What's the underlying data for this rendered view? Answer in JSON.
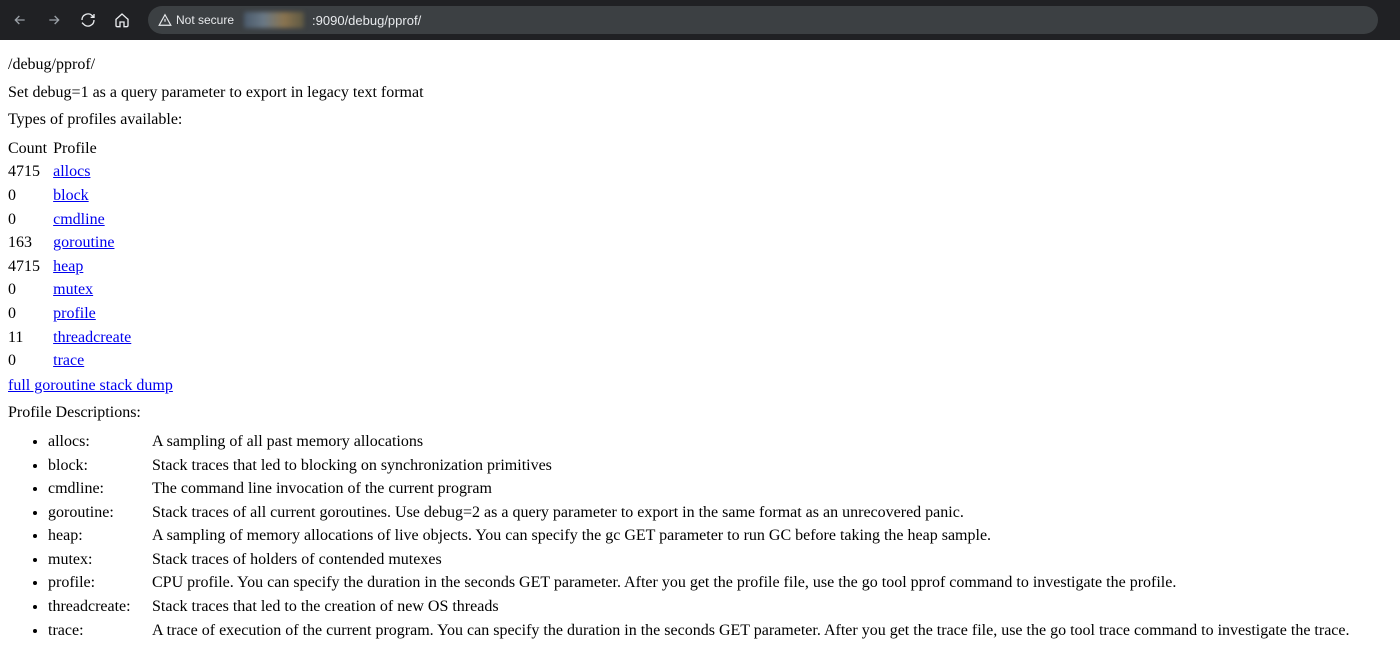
{
  "chrome": {
    "not_secure_label": "Not secure",
    "url": ":9090/debug/pprof/"
  },
  "page": {
    "heading": "/debug/pprof/",
    "subtext": "Set debug=1 as a query parameter to export in legacy text format",
    "types_label": "Types of profiles available:",
    "table_headers": {
      "count": "Count",
      "profile": "Profile"
    },
    "profiles": [
      {
        "count": "4715",
        "name": "allocs"
      },
      {
        "count": "0",
        "name": "block"
      },
      {
        "count": "0",
        "name": "cmdline"
      },
      {
        "count": "163",
        "name": "goroutine"
      },
      {
        "count": "4715",
        "name": "heap"
      },
      {
        "count": "0",
        "name": "mutex"
      },
      {
        "count": "0",
        "name": "profile"
      },
      {
        "count": "11",
        "name": "threadcreate"
      },
      {
        "count": "0",
        "name": "trace"
      }
    ],
    "full_dump_label": "full goroutine stack dump",
    "descriptions_label": "Profile Descriptions:",
    "descriptions": [
      {
        "name": "allocs:",
        "text": "A sampling of all past memory allocations"
      },
      {
        "name": "block:",
        "text": "Stack traces that led to blocking on synchronization primitives"
      },
      {
        "name": "cmdline:",
        "text": "The command line invocation of the current program"
      },
      {
        "name": "goroutine:",
        "text": "Stack traces of all current goroutines. Use debug=2 as a query parameter to export in the same format as an unrecovered panic."
      },
      {
        "name": "heap:",
        "text": "A sampling of memory allocations of live objects. You can specify the gc GET parameter to run GC before taking the heap sample."
      },
      {
        "name": "mutex:",
        "text": "Stack traces of holders of contended mutexes"
      },
      {
        "name": "profile:",
        "text": "CPU profile. You can specify the duration in the seconds GET parameter. After you get the profile file, use the go tool pprof command to investigate the profile."
      },
      {
        "name": "threadcreate:",
        "text": "Stack traces that led to the creation of new OS threads"
      },
      {
        "name": "trace:",
        "text": "A trace of execution of the current program. You can specify the duration in the seconds GET parameter. After you get the trace file, use the go tool trace command to investigate the trace."
      }
    ]
  }
}
